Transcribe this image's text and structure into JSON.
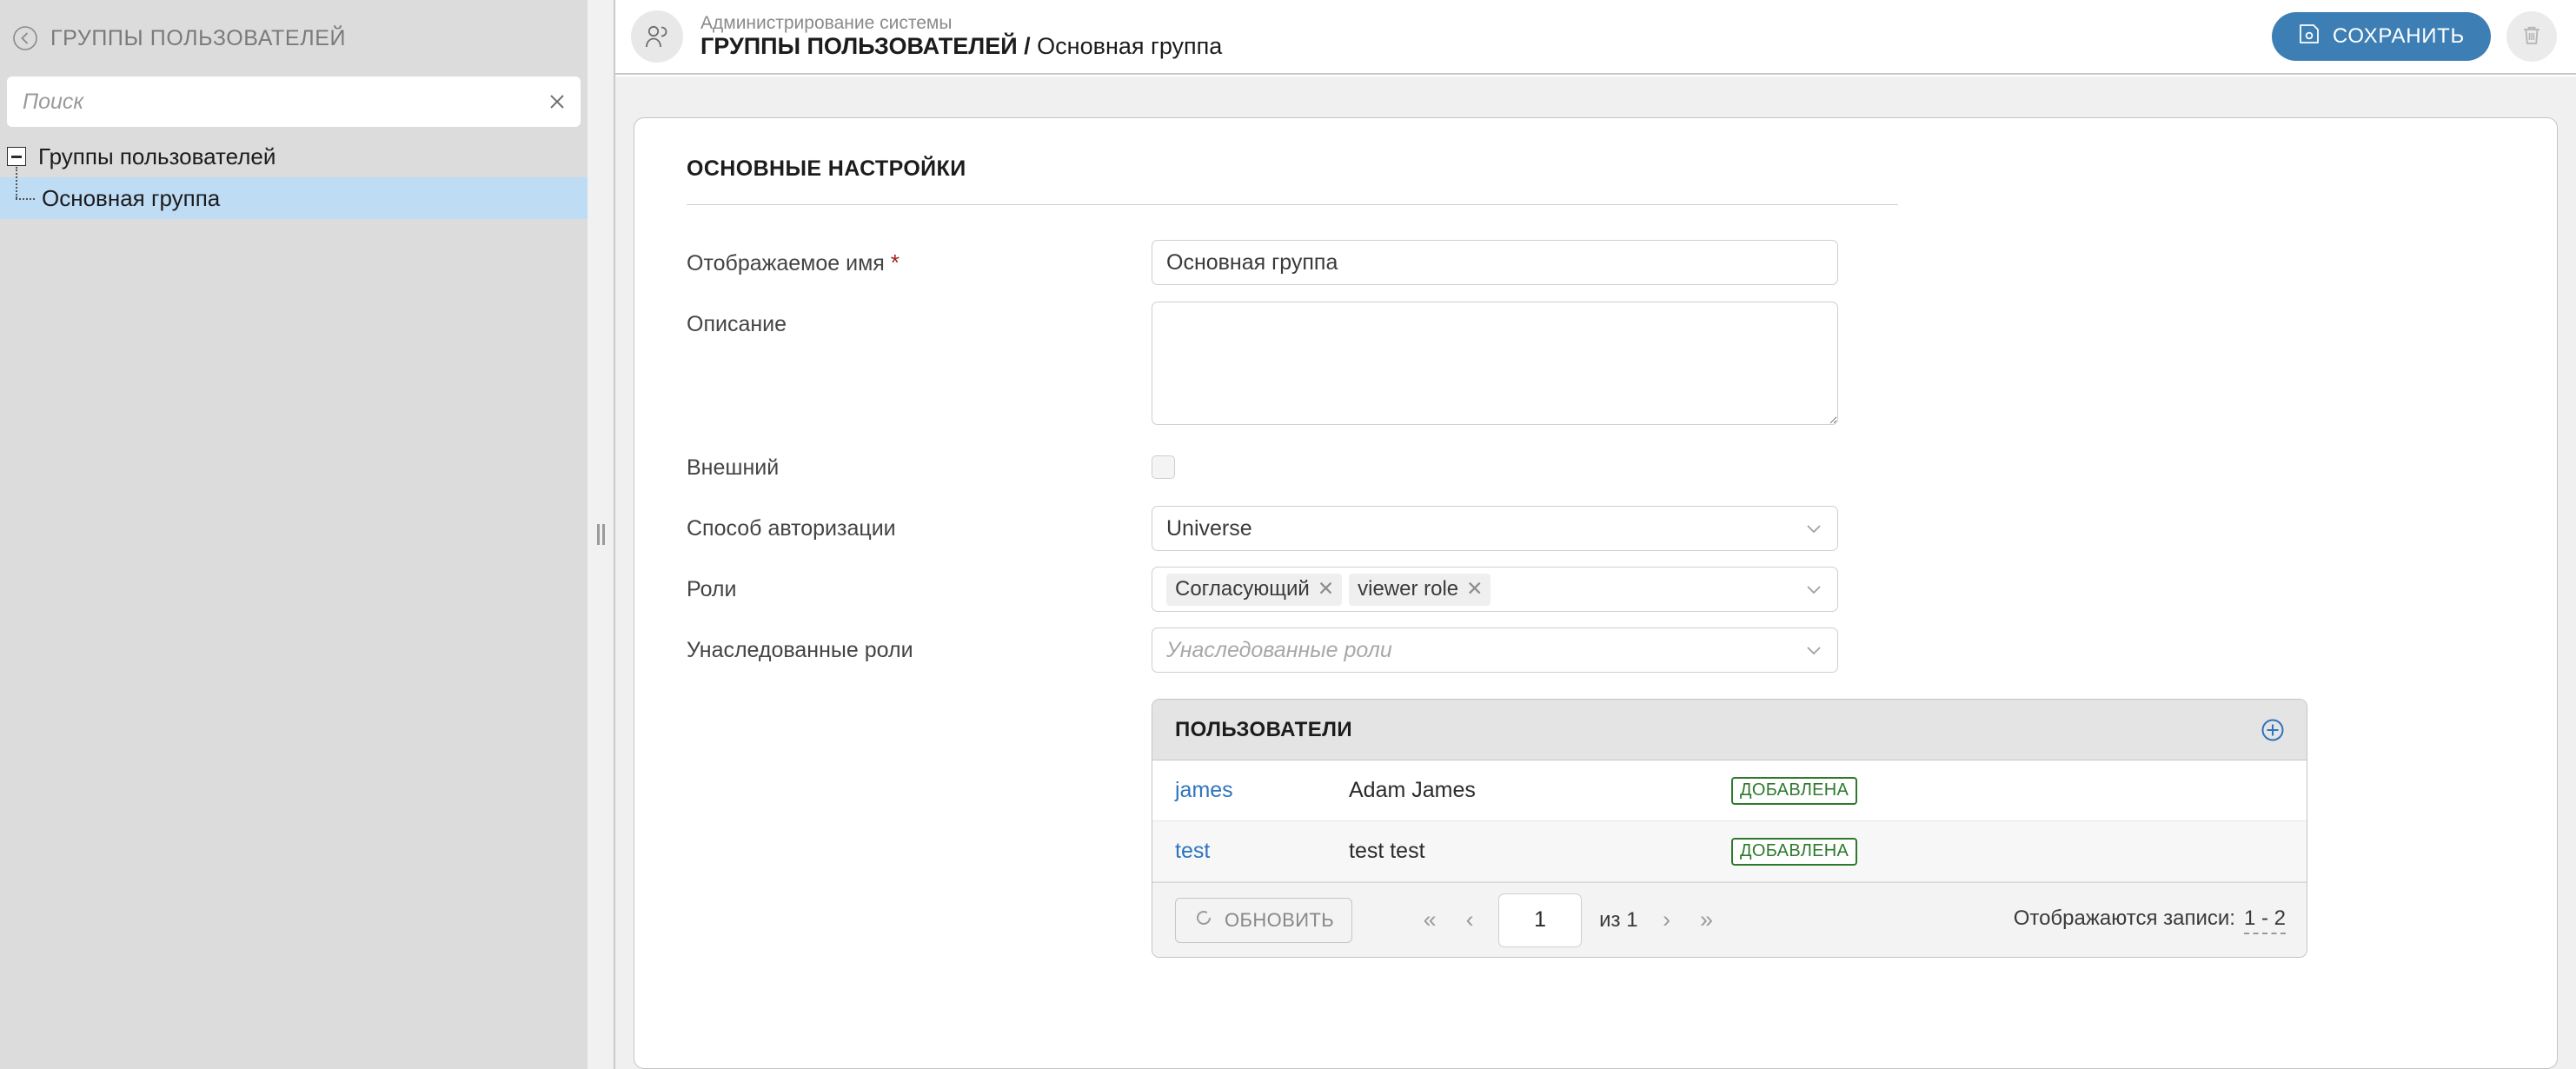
{
  "sidebar": {
    "collapse_icon": "chevron-left-circle-icon",
    "title": "ГРУППЫ ПОЛЬЗОВАТЕЛЕЙ",
    "search": {
      "placeholder": "Поиск",
      "value": "",
      "clear_icon": "close-icon"
    },
    "tree": [
      {
        "label": "Группы пользователей",
        "level": 0,
        "expanded": true,
        "selected": false
      },
      {
        "label": "Основная группа",
        "level": 1,
        "expanded": false,
        "selected": true
      }
    ]
  },
  "topbar": {
    "avatar_icon": "users-group-icon",
    "breadcrumb_parent": "Администрирование системы",
    "breadcrumb_section": "ГРУППЫ ПОЛЬЗОВАТЕЛЕЙ",
    "breadcrumb_divider": " / ",
    "breadcrumb_current": "Основная группа",
    "save_label": "СОХРАНИТЬ",
    "save_icon": "save-floppy-icon",
    "delete_icon": "trash-icon",
    "accent_color": "#3d7fb5"
  },
  "card": {
    "title": "ОСНОВНЫЕ НАСТРОЙКИ",
    "fields": {
      "display_name": {
        "label": "Отображаемое имя",
        "required_mark": "*",
        "value": "Основная группа"
      },
      "description": {
        "label": "Описание",
        "value": ""
      },
      "external": {
        "label": "Внешний",
        "checked": false
      },
      "auth_method": {
        "label": "Способ авторизации",
        "value": "Universe"
      },
      "roles": {
        "label": "Роли",
        "tags": [
          "Согласующий",
          "viewer role"
        ],
        "remove_icon": "close-icon"
      },
      "inherited_roles": {
        "label": "Унаследованные роли",
        "placeholder": "Унаследованные роли",
        "value": ""
      }
    }
  },
  "users_table": {
    "title": "ПОЛЬЗОВАТЕЛИ",
    "add_icon": "plus-circle-icon",
    "rows": [
      {
        "login": "james",
        "name": "Adam  James",
        "status": "ДОБАВЛЕНА"
      },
      {
        "login": "test",
        "name": "test  test",
        "status": "ДОБАВЛЕНА"
      }
    ],
    "status_color": "#2d7a2d",
    "footer": {
      "refresh_label": "ОБНОВИТЬ",
      "refresh_icon": "refresh-icon",
      "first_icon": "double-chevron-left-icon",
      "prev_icon": "chevron-left-icon",
      "next_icon": "chevron-right-icon",
      "last_icon": "double-chevron-right-icon",
      "page_value": "1",
      "of_label": "из 1",
      "records_label": "Отображаются записи:",
      "records_value": "1 - 2"
    }
  }
}
